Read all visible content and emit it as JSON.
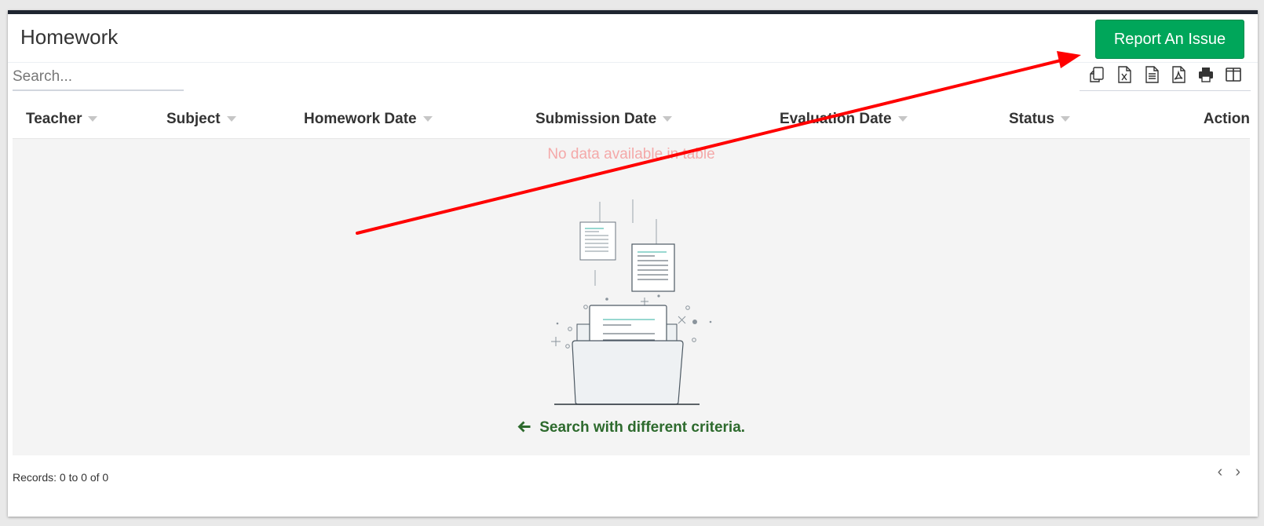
{
  "panel": {
    "title": "Homework",
    "report_button": "Report An Issue"
  },
  "search": {
    "placeholder": "Search..."
  },
  "toolbar": {
    "buttons": [
      "copy-icon",
      "excel-icon",
      "csv-icon",
      "pdf-icon",
      "print-icon",
      "columns-icon"
    ]
  },
  "table": {
    "columns": [
      "Teacher",
      "Subject",
      "Homework Date",
      "Submission Date",
      "Evaluation Date",
      "Status",
      "Action"
    ],
    "empty_message": "No data available in table",
    "empty_hint": "Search with different criteria.",
    "empty_hint_icon": "arrow-left-icon"
  },
  "footer": {
    "records": "Records: 0 to 0 of 0",
    "prev": "‹",
    "next": "›"
  },
  "colors": {
    "accent_green": "#00a65a",
    "hint_green": "#2d6a2d",
    "empty_text": "#f4a9a9",
    "annotation_arrow": "#ff0000",
    "top_border": "#1f2530"
  }
}
